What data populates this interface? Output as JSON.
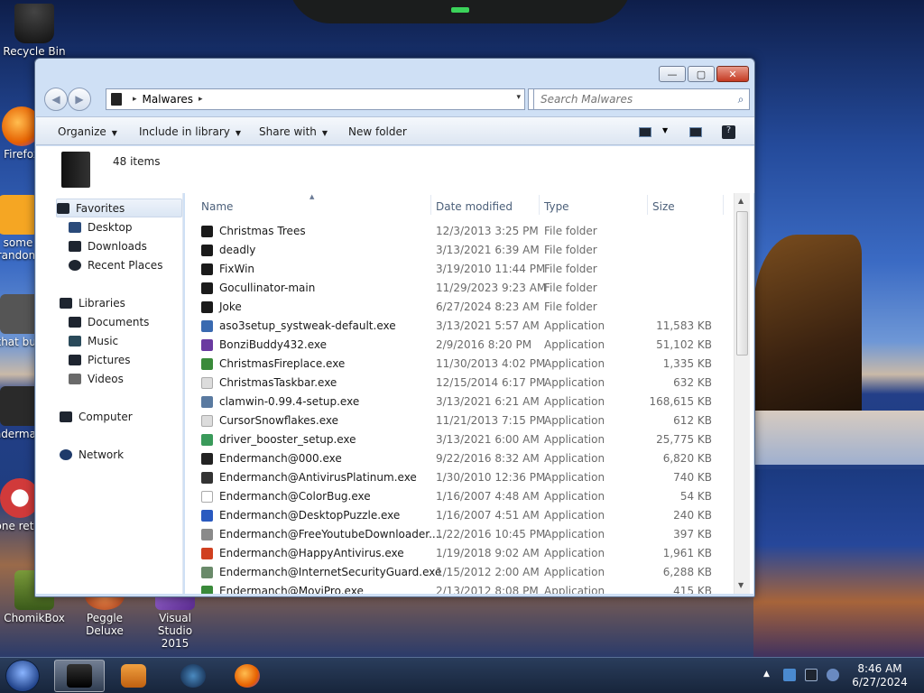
{
  "desktop": {
    "icons": [
      {
        "label": "Recycle Bin",
        "name": "recycle-bin-icon",
        "color": "#c0392b"
      },
      {
        "label": "Firefox",
        "name": "firefox-icon",
        "color": "#e66000"
      },
      {
        "label": "some random",
        "name": "desktop-app-icon",
        "color": "#f5a623"
      },
      {
        "label": "that bug",
        "name": "desktop-app-icon",
        "color": "#666666"
      },
      {
        "label": "Endermanch",
        "name": "desktop-app-icon",
        "color": "#333333"
      },
      {
        "label": "none retard",
        "name": "desktop-app-icon",
        "color": "#d13a3a"
      },
      {
        "label": "ChomikBox",
        "name": "chomikbox-icon",
        "color": "#7a9a3a"
      },
      {
        "label": "Peggle Deluxe",
        "name": "peggle-icon",
        "color": "#d15a2a"
      },
      {
        "label": "Visual Studio 2015",
        "name": "visual-studio-icon",
        "color": "#6a3aa0"
      }
    ]
  },
  "window": {
    "caption_buttons": {
      "minimize": "—",
      "maximize": "▢",
      "close": "✕"
    },
    "address": {
      "root_sep": "▸",
      "folder": "Malwares",
      "trail_sep": "▸",
      "dropdown": "▾"
    },
    "search": {
      "placeholder": "Search Malwares"
    },
    "toolbar": {
      "organize": "Organize",
      "include_in_library": "Include in library",
      "share_with": "Share with",
      "new_folder": "New folder"
    },
    "info": {
      "count": "48 items"
    },
    "nav": {
      "favorites": "Favorites",
      "desktop": "Desktop",
      "downloads": "Downloads",
      "recent_places": "Recent Places",
      "libraries": "Libraries",
      "documents": "Documents",
      "music": "Music",
      "pictures": "Pictures",
      "videos": "Videos",
      "computer": "Computer",
      "network": "Network"
    },
    "columns": {
      "name": "Name",
      "date": "Date modified",
      "type": "Type",
      "size": "Size"
    },
    "rows": [
      {
        "name": "Christmas Trees",
        "date": "12/3/2013 3:25 PM",
        "type": "File folder",
        "size": "",
        "color": "#1a1a1a"
      },
      {
        "name": "deadly",
        "date": "3/13/2021 6:39 AM",
        "type": "File folder",
        "size": "",
        "color": "#1a1a1a"
      },
      {
        "name": "FixWin",
        "date": "3/19/2010 11:44 PM",
        "type": "File folder",
        "size": "",
        "color": "#1a1a1a"
      },
      {
        "name": "Gocullinator-main",
        "date": "11/29/2023 9:23 AM",
        "type": "File folder",
        "size": "",
        "color": "#1a1a1a"
      },
      {
        "name": "Joke",
        "date": "6/27/2024 8:23 AM",
        "type": "File folder",
        "size": "",
        "color": "#1a1a1a"
      },
      {
        "name": "aso3setup_systweak-default.exe",
        "date": "3/13/2021 5:57 AM",
        "type": "Application",
        "size": "11,583 KB",
        "color": "#3a6ab0"
      },
      {
        "name": "BonziBuddy432.exe",
        "date": "2/9/2016 8:20 PM",
        "type": "Application",
        "size": "51,102 KB",
        "color": "#6a3aa0"
      },
      {
        "name": "ChristmasFireplace.exe",
        "date": "11/30/2013 4:02 PM",
        "type": "Application",
        "size": "1,335 KB",
        "color": "#3a8a3a"
      },
      {
        "name": "ChristmasTaskbar.exe",
        "date": "12/15/2014 6:17 PM",
        "type": "Application",
        "size": "632 KB",
        "color": "#dcdcdc"
      },
      {
        "name": "clamwin-0.99.4-setup.exe",
        "date": "3/13/2021 6:21 AM",
        "type": "Application",
        "size": "168,615 KB",
        "color": "#5a7aa0"
      },
      {
        "name": "CursorSnowflakes.exe",
        "date": "11/21/2013 7:15 PM",
        "type": "Application",
        "size": "612 KB",
        "color": "#dcdcdc"
      },
      {
        "name": "driver_booster_setup.exe",
        "date": "3/13/2021 6:00 AM",
        "type": "Application",
        "size": "25,775 KB",
        "color": "#3a9a5a"
      },
      {
        "name": "Endermanch@000.exe",
        "date": "9/22/2016 8:32 AM",
        "type": "Application",
        "size": "6,820 KB",
        "color": "#222222"
      },
      {
        "name": "Endermanch@AntivirusPlatinum.exe",
        "date": "1/30/2010 12:36 PM",
        "type": "Application",
        "size": "740 KB",
        "color": "#333333"
      },
      {
        "name": "Endermanch@ColorBug.exe",
        "date": "1/16/2007 4:48 AM",
        "type": "Application",
        "size": "54 KB",
        "color": "#ffffff"
      },
      {
        "name": "Endermanch@DesktopPuzzle.exe",
        "date": "1/16/2007 4:51 AM",
        "type": "Application",
        "size": "240 KB",
        "color": "#2a5ac0"
      },
      {
        "name": "Endermanch@FreeYoutubeDownloader....",
        "date": "1/22/2016 10:45 PM",
        "type": "Application",
        "size": "397 KB",
        "color": "#8a8a8a"
      },
      {
        "name": "Endermanch@HappyAntivirus.exe",
        "date": "1/19/2018 9:02 AM",
        "type": "Application",
        "size": "1,961 KB",
        "color": "#d04020"
      },
      {
        "name": "Endermanch@InternetSecurityGuard.exe",
        "date": "1/15/2012 2:00 AM",
        "type": "Application",
        "size": "6,288 KB",
        "color": "#6a8a6a"
      },
      {
        "name": "Endermanch@MoviPro.exe",
        "date": "2/13/2012 8:08 PM",
        "type": "Application",
        "size": "415 KB",
        "color": "#3a8a3a"
      }
    ]
  },
  "taskbar": {
    "clock": {
      "time": "8:46 AM",
      "date": "6/27/2024"
    },
    "tray_arrow": "▲"
  }
}
